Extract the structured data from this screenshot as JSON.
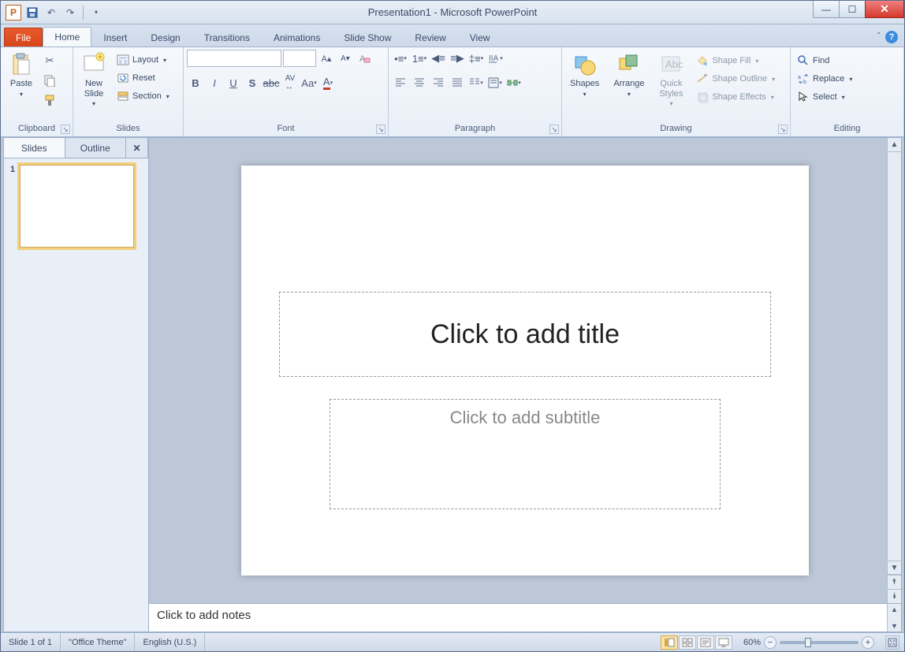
{
  "window": {
    "title": "Presentation1 - Microsoft PowerPoint"
  },
  "qat": {
    "tip_save": "Save",
    "tip_undo": "Undo",
    "tip_redo": "Redo"
  },
  "tabs": {
    "file": "File",
    "home": "Home",
    "insert": "Insert",
    "design": "Design",
    "transitions": "Transitions",
    "animations": "Animations",
    "slideshow": "Slide Show",
    "review": "Review",
    "view": "View"
  },
  "ribbon": {
    "clipboard": {
      "label": "Clipboard",
      "paste": "Paste"
    },
    "slides": {
      "label": "Slides",
      "new_slide": "New\nSlide",
      "layout": "Layout",
      "reset": "Reset",
      "section": "Section"
    },
    "font": {
      "label": "Font"
    },
    "paragraph": {
      "label": "Paragraph"
    },
    "drawing": {
      "label": "Drawing",
      "shapes": "Shapes",
      "arrange": "Arrange",
      "quick_styles": "Quick\nStyles",
      "shape_fill": "Shape Fill",
      "shape_outline": "Shape Outline",
      "shape_effects": "Shape Effects"
    },
    "editing": {
      "label": "Editing",
      "find": "Find",
      "replace": "Replace",
      "select": "Select"
    }
  },
  "panel": {
    "slides_tab": "Slides",
    "outline_tab": "Outline",
    "thumb_num": "1"
  },
  "slide": {
    "title_placeholder": "Click to add title",
    "subtitle_placeholder": "Click to add subtitle"
  },
  "notes": {
    "placeholder": "Click to add notes"
  },
  "status": {
    "slide_info": "Slide 1 of 1",
    "theme": "\"Office Theme\"",
    "lang": "English (U.S.)",
    "zoom": "60%"
  }
}
